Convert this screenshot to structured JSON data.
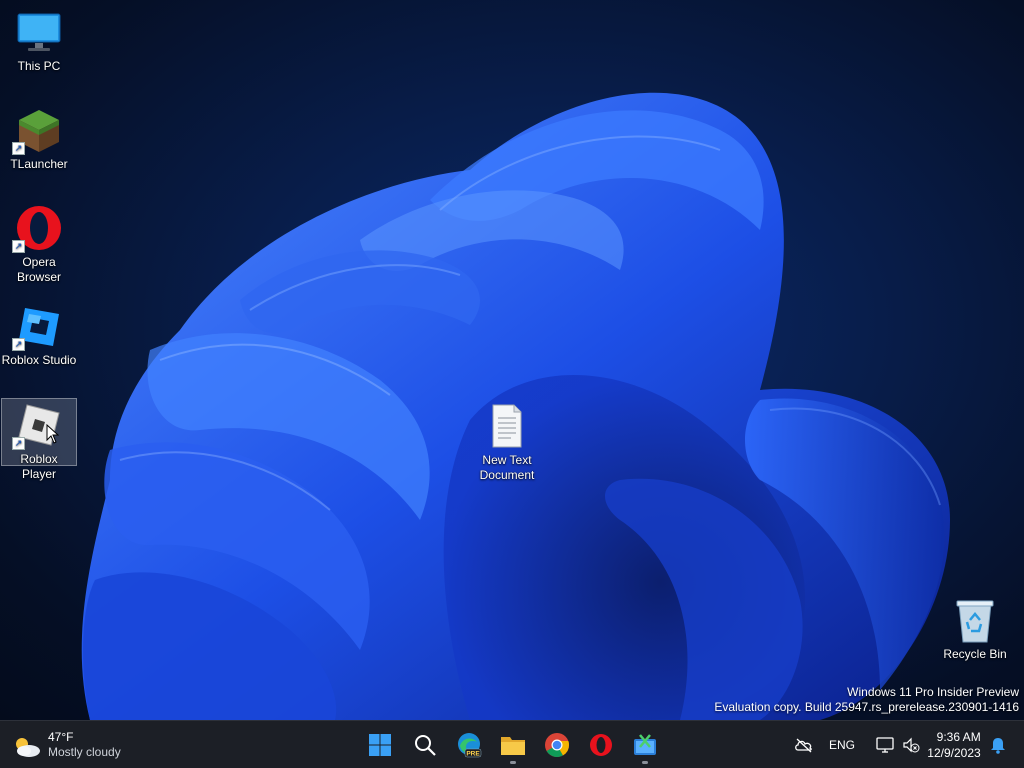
{
  "desktop": {
    "icons": [
      {
        "label": "This PC",
        "icon": "monitor-icon"
      },
      {
        "label": "TLauncher",
        "icon": "minecraft-grass-block-icon"
      },
      {
        "label": "Opera Browser",
        "icon": "opera-icon"
      },
      {
        "label": "Roblox Studio",
        "icon": "roblox-studio-icon"
      },
      {
        "label": "Roblox Player",
        "icon": "roblox-player-icon"
      },
      {
        "label": "New Text Document",
        "icon": "text-document-icon"
      },
      {
        "label": "Recycle Bin",
        "icon": "recycle-bin-icon"
      }
    ],
    "watermark": {
      "line1": "Windows 11 Pro Insider Preview",
      "line2": "Evaluation copy. Build 25947.rs_prerelease.230901-1416"
    }
  },
  "taskbar": {
    "weather": {
      "temperature": "47°F",
      "condition": "Mostly cloudy",
      "icon": "partly-cloudy-icon"
    },
    "apps": [
      {
        "name": "Start",
        "icon": "windows-start-icon"
      },
      {
        "name": "Search",
        "icon": "search-icon"
      },
      {
        "name": "Microsoft Edge Preview",
        "icon": "edge-pre-icon",
        "badge": "PRE"
      },
      {
        "name": "File Explorer",
        "icon": "folder-icon"
      },
      {
        "name": "Google Chrome",
        "icon": "chrome-icon"
      },
      {
        "name": "Opera",
        "icon": "opera-icon"
      },
      {
        "name": "Snipping Tool",
        "icon": "snipping-tool-icon"
      }
    ],
    "tray": {
      "language": "ENG",
      "time": "9:36 AM",
      "date": "12/9/2023"
    }
  },
  "colors": {
    "taskbar_bg": "#1c1f26",
    "wallpaper_blue": "#1f4fe0",
    "opera_red": "#e8121d",
    "roblox_blue": "#1e9bff"
  }
}
